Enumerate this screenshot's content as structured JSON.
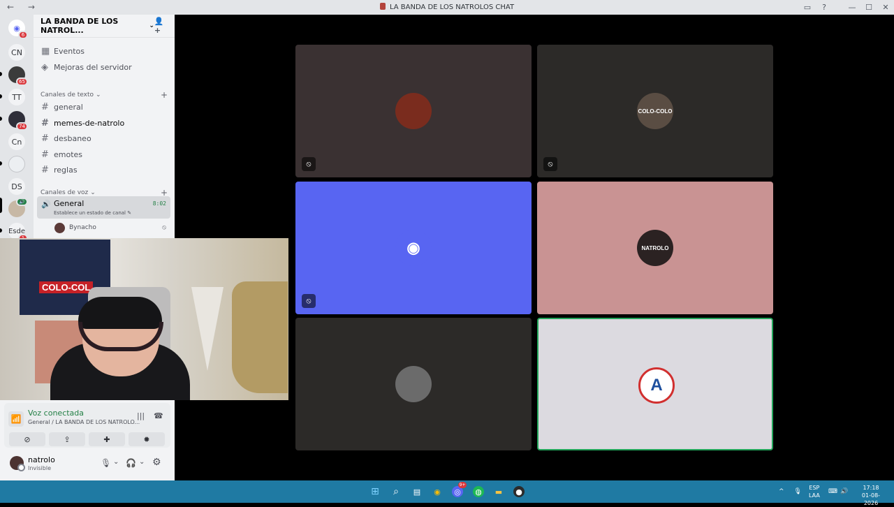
{
  "window": {
    "nav_arrows": "← →",
    "title": "LA BANDA DE LOS NATROLOS CHAT",
    "controls": [
      "▭",
      "?",
      "—",
      "☐",
      "✕"
    ]
  },
  "guilds": {
    "items": [
      {
        "label": "",
        "badge": "6"
      },
      {
        "label": "CN",
        "badge": ""
      },
      {
        "label": "",
        "badge": "65"
      },
      {
        "label": "TT",
        "badge": ""
      },
      {
        "label": "",
        "badge": "74"
      },
      {
        "label": "Cn",
        "badge": ""
      },
      {
        "label": "",
        "badge": ""
      },
      {
        "label": "DS",
        "badge": ""
      },
      {
        "label": "",
        "badge": ""
      },
      {
        "label": "Esde",
        "badge": "1"
      }
    ]
  },
  "sidebar": {
    "server_name": "LA BANDA DE LOS NATROL...",
    "server_chevron": "⌄",
    "invite_icon": "👤+",
    "top_items": [
      {
        "label": "Eventos",
        "icon": "▦"
      },
      {
        "label": "Mejoras del servidor",
        "icon": "◈"
      }
    ],
    "text_category": "Canales de texto",
    "voice_category": "Canales de voz",
    "cat_chevron": "⌄",
    "plus": "+",
    "text_channels": [
      "general",
      "memes-de-natrolo",
      "desbaneo",
      "emotes",
      "reglas"
    ],
    "hash": "#",
    "voice_channel": {
      "name": "General",
      "status": "Establece un estado de canal ✎",
      "time": "8:02",
      "speaker_icon": "🔊"
    },
    "member": {
      "name": "Bynacho",
      "mute_icon": "⦸"
    }
  },
  "voice_panel": {
    "signal_icon": "📶",
    "status": "Voz conectada",
    "subtitle": "General / LA BANDA DE LOS NATROLO...",
    "noise_icon": "|||",
    "disconnect_icon": "☎",
    "buttons": [
      "⊘",
      "⇪",
      "✚",
      "✹"
    ]
  },
  "user": {
    "name": "natrolo",
    "status": "Invisible",
    "mic_icon": "🎙",
    "headphone_icon": "🎧",
    "gear_icon": "⚙",
    "chevron": "⌄"
  },
  "webcam": {
    "flag_text": "COLO-COL"
  },
  "tiles": [
    {
      "bg": "#3a3132",
      "avatar_bg": "#7a2c1e",
      "avatar_text": "",
      "muted": true
    },
    {
      "bg": "#2c2a28",
      "avatar_bg": "#5a4d43",
      "avatar_text": "COLO-COLO",
      "muted": true
    },
    {
      "bg": "#5865f2",
      "avatar_bg": "#5865f2",
      "avatar_text": "discord",
      "muted": true
    },
    {
      "bg": "#c99393",
      "avatar_bg": "#2b2222",
      "avatar_text": "NATROLO",
      "muted": false
    },
    {
      "bg": "#2c2a28",
      "avatar_bg": "#6b6b6b",
      "avatar_text": "",
      "muted": false
    },
    {
      "bg": "#dcdae0",
      "avatar_bg": "#ffffff",
      "avatar_text": "A",
      "muted": false
    }
  ],
  "mute_icon": "⦸",
  "taskbar": {
    "apps": [
      "⊞",
      "⌕",
      "▤",
      "◉",
      "◎",
      "◍",
      "▬",
      "●"
    ],
    "discord_badge": "9+",
    "tray_chevron": "^",
    "lang": "ESP",
    "layout": "LAA",
    "time": "17:18",
    "date": "01-08-2026",
    "mic": "🎙",
    "net": "⌨",
    "vol": "🔊"
  },
  "colors": {
    "accent_green": "#248046",
    "discord_blurple": "#5865f2",
    "taskbar": "#1f7aa3"
  }
}
